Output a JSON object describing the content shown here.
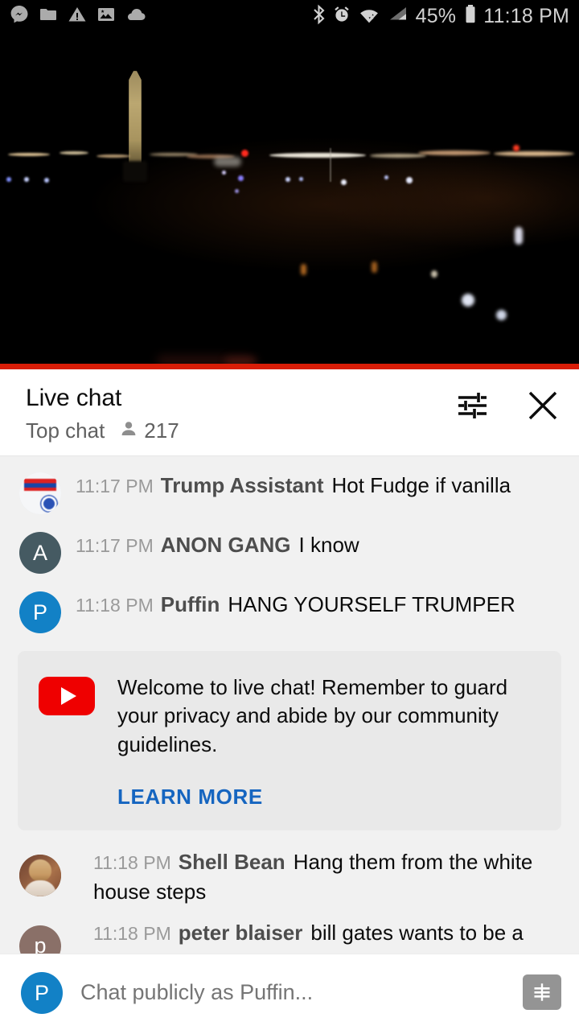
{
  "status_bar": {
    "left_icons": [
      "messenger-icon",
      "folder-icon",
      "warning-icon",
      "image-icon",
      "cloud-icon"
    ],
    "right_icons": [
      "bluetooth-icon",
      "alarm-icon",
      "wifi-icon",
      "cell-signal-icon",
      "battery-icon"
    ],
    "battery_percent": "45%",
    "time": "11:18 PM",
    "background": "#000000",
    "foreground": "#d2d2d2"
  },
  "video": {
    "name": "live-stream-video",
    "description": "Washington Monument at night cityscape",
    "live_bar_color": "#d81d07"
  },
  "chat_header": {
    "title": "Live chat",
    "mode": "Top chat",
    "viewer_icon": "person-icon",
    "viewer_count": "217",
    "settings_icon": "tune-icon",
    "close_icon": "close-icon"
  },
  "messages": [
    {
      "avatar_type": "image",
      "avatar_class": "tshirt",
      "avatar_letter": "",
      "time": "11:17 PM",
      "author": "Trump Assistant",
      "text": "Hot Fudge if vanilla",
      "wide": false
    },
    {
      "avatar_type": "letter",
      "avatar_class": "anon",
      "avatar_letter": "A",
      "time": "11:17 PM",
      "author": "ANON GANG",
      "text": "I know",
      "wide": false
    },
    {
      "avatar_type": "letter",
      "avatar_class": "puffin",
      "avatar_letter": "P",
      "time": "11:18 PM",
      "author": "Puffin",
      "text": "HANG YOURSELF TRUMPER",
      "wide": false
    }
  ],
  "welcome_card": {
    "logo": "youtube-logo-icon",
    "text": "Welcome to live chat! Remember to guard your privacy and abide by our community guidelines.",
    "link_label": "LEARN MORE",
    "link_color": "#1565c0",
    "background": "#e9e9e9"
  },
  "messages_after": [
    {
      "avatar_type": "image",
      "avatar_class": "shell",
      "avatar_letter": "",
      "time": "11:18 PM",
      "author": "Shell Bean",
      "text": "Hang them from the white house steps",
      "wide": true
    },
    {
      "avatar_type": "letter",
      "avatar_class": "peter",
      "avatar_letter": "p",
      "time": "11:18 PM",
      "author": "peter blaiser",
      "text": "bill gates wants to be a scientific loool",
      "wide": true
    }
  ],
  "input_bar": {
    "avatar_letter": "P",
    "avatar_color": "#1281c6",
    "placeholder": "Chat publicly as Puffin...",
    "superchat_icon": "dollar-bill-icon"
  }
}
